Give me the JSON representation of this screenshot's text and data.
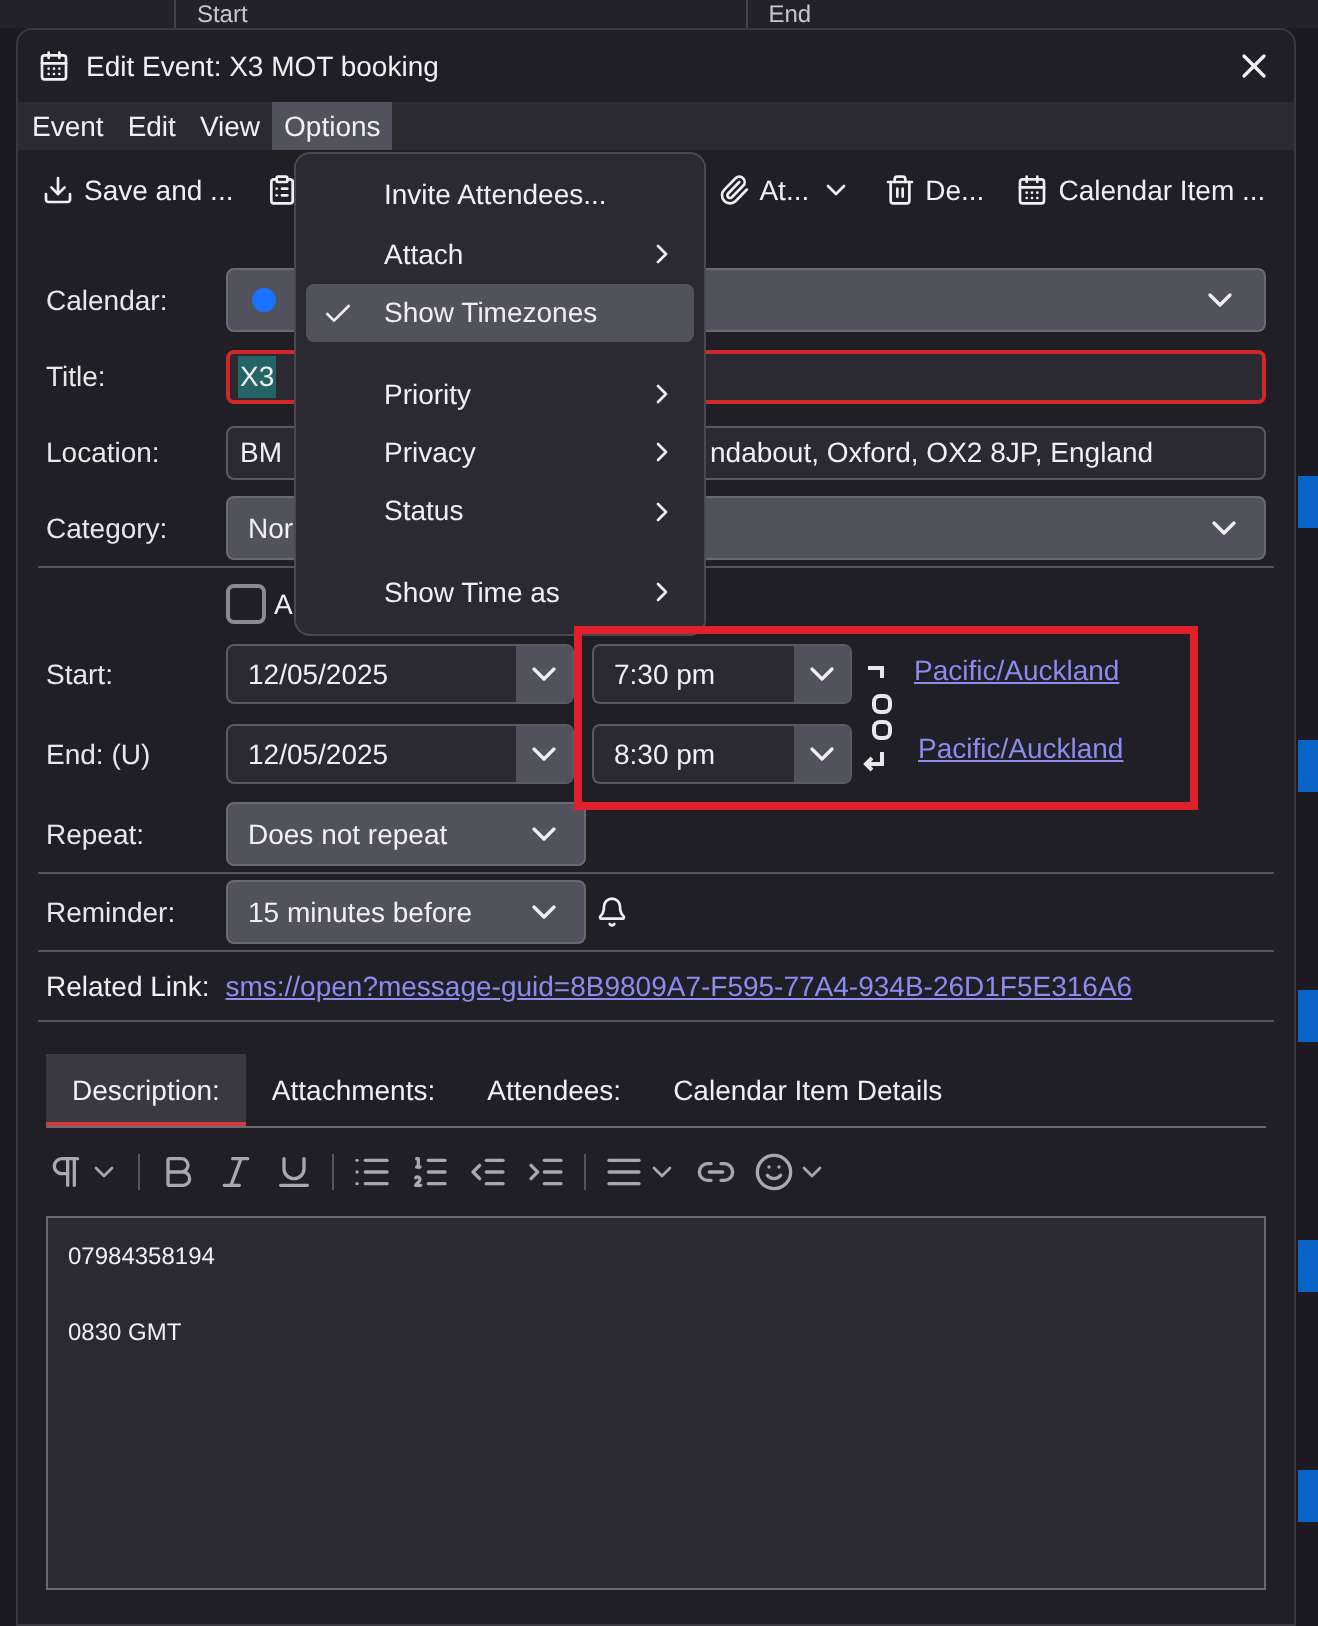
{
  "background": {
    "columns": [
      "Start",
      "End"
    ]
  },
  "window": {
    "title": "Edit Event: X3 MOT booking"
  },
  "menubar": [
    {
      "label": "Event",
      "selected": false
    },
    {
      "label": "Edit",
      "selected": false
    },
    {
      "label": "View",
      "selected": false
    },
    {
      "label": "Options",
      "selected": true
    }
  ],
  "toolbar": [
    {
      "kind": "save",
      "label": "Save and ..."
    },
    {
      "kind": "invite"
    },
    {
      "kind": "attach",
      "label": "At..."
    },
    {
      "kind": "delete",
      "label": "De..."
    },
    {
      "kind": "details",
      "label": "Calendar Item ..."
    }
  ],
  "options_menu": [
    {
      "label": "Invite Attendees...",
      "kind": "item",
      "checked": false,
      "selected": false
    },
    {
      "label": "Attach",
      "kind": "submenu",
      "checked": false,
      "selected": false
    },
    {
      "label": "Show Timezones",
      "kind": "item",
      "checked": true,
      "selected": true
    },
    {
      "label": "Priority",
      "kind": "submenu",
      "checked": false,
      "selected": false
    },
    {
      "label": "Privacy",
      "kind": "submenu",
      "checked": false,
      "selected": false
    },
    {
      "label": "Status",
      "kind": "submenu",
      "checked": false,
      "selected": false
    },
    {
      "label": "Show Time as",
      "kind": "submenu",
      "checked": false,
      "selected": false
    }
  ],
  "form": {
    "calendar": {
      "label": "Calendar:",
      "color": "#1a73ff"
    },
    "title": {
      "label": "Title:",
      "value": "X3"
    },
    "location": {
      "label": "Location:",
      "value_start": "BM",
      "value_end": "ndabout, Oxford, OX2 8JP, England"
    },
    "category": {
      "label": "Category:",
      "value": "Nor"
    },
    "all_day": {
      "label": "A",
      "checked": false
    },
    "start": {
      "label": "Start:",
      "date": "12/05/2025",
      "time": "7:30 pm",
      "timezone": "Pacific/Auckland"
    },
    "end": {
      "label": "End: (U)",
      "date": "12/05/2025",
      "time": "8:30 pm",
      "timezone": "Pacific/Auckland"
    },
    "repeat": {
      "label": "Repeat:",
      "value": "Does not repeat"
    },
    "reminder": {
      "label": "Reminder:",
      "value": "15 minutes before"
    },
    "related_link": {
      "label": "Related Link:",
      "value": "sms://open?message-guid=8B9809A7-F595-77A4-934B-26D1F5E316A6"
    }
  },
  "tabs": [
    {
      "label": "Description:",
      "selected": true
    },
    {
      "label": "Attachments:",
      "selected": false
    },
    {
      "label": "Attendees:",
      "selected": false
    },
    {
      "label": "Calendar Item Details",
      "selected": false
    }
  ],
  "description": [
    "07984358194",
    "0830 GMT"
  ]
}
